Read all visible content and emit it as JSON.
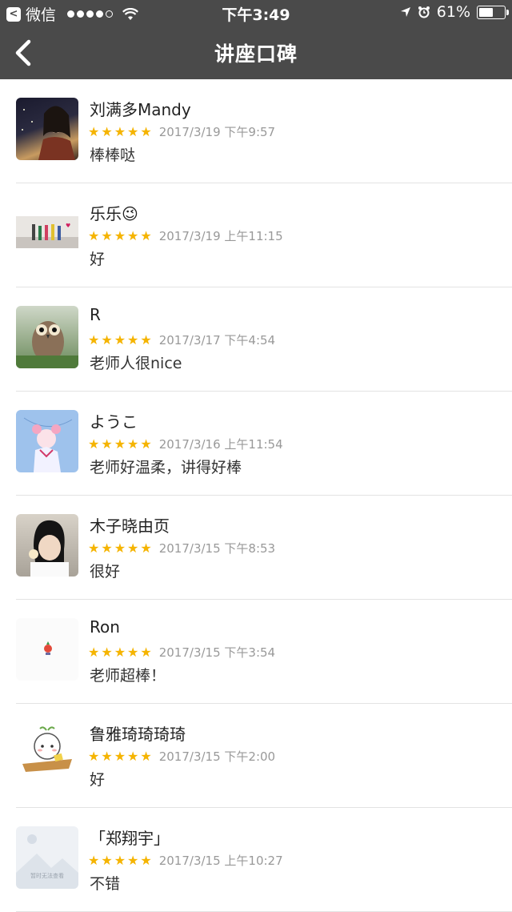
{
  "status_bar": {
    "back_app_label": "微信",
    "time": "下午3:49",
    "battery": "61%",
    "battery_level": 0.61
  },
  "nav": {
    "title": "讲座口碑"
  },
  "reviews": [
    {
      "name": "刘满多Mandy",
      "date": "2017/3/19 下午9:57",
      "comment": "棒棒哒",
      "rating": 5
    },
    {
      "name": "乐乐😉",
      "date": "2017/3/19 上午11:15",
      "comment": "好",
      "rating": 5
    },
    {
      "name": "R",
      "date": "2017/3/17 下午4:54",
      "comment": "老师人很nice",
      "rating": 5
    },
    {
      "name": "ようこ",
      "date": "2017/3/16 上午11:54",
      "comment": "老师好温柔，讲得好棒",
      "rating": 5
    },
    {
      "name": "木子晓由页",
      "date": "2017/3/15 下午8:53",
      "comment": "很好",
      "rating": 5
    },
    {
      "name": "Ron",
      "date": "2017/3/15 下午3:54",
      "comment": "老师超棒！",
      "rating": 5
    },
    {
      "name": "鲁雅琦琦琦琦",
      "date": "2017/3/15 下午2:00",
      "comment": "好",
      "rating": 5
    },
    {
      "name": "「郑翔宇」",
      "date": "2017/3/15 上午10:27",
      "comment": "不错",
      "rating": 5
    }
  ],
  "placeholder_avatar_text": "暂时无法查看"
}
